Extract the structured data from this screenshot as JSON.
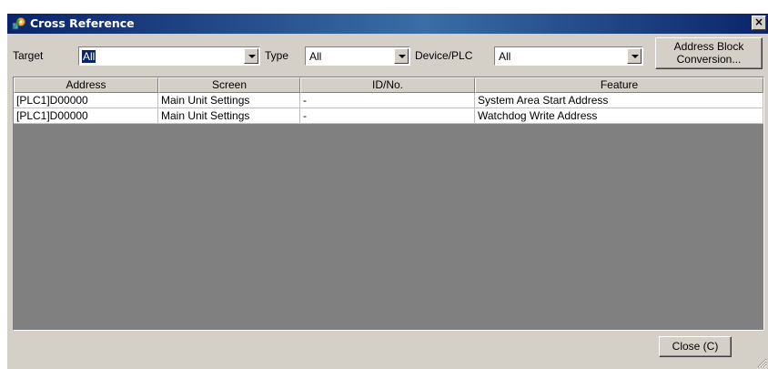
{
  "window": {
    "title": "Cross Reference",
    "close_glyph": "×"
  },
  "filters": {
    "target_label": "Target",
    "target_value": "All",
    "type_label": "Type",
    "type_value": "All",
    "device_label": "Device/PLC",
    "device_value": "All",
    "conversion_line1": "Address Block",
    "conversion_line2": "Conversion..."
  },
  "table": {
    "columns": [
      "Address",
      "Screen",
      "ID/No.",
      "Feature"
    ],
    "rows": [
      [
        "[PLC1]D00000",
        "Main Unit Settings",
        "-",
        "System Area Start Address"
      ],
      [
        "[PLC1]D00000",
        "Main Unit Settings",
        "-",
        "Watchdog Write Address"
      ]
    ]
  },
  "footer": {
    "close_label": "Close (C)"
  },
  "icons": {
    "title": "cross-reference-app-icon",
    "dropdown": "chevron-down-icon",
    "resize": "resize-grip-icon"
  },
  "colors": {
    "titlebar": "#0a246a",
    "face": "#d4d0c8",
    "grid_empty": "#808080",
    "selection": "#0a246a"
  }
}
